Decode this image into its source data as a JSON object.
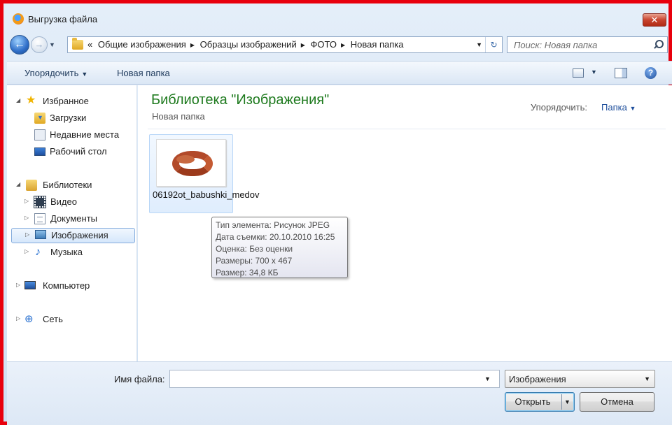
{
  "window": {
    "title": "Выгрузка файла",
    "close_glyph": "✕"
  },
  "navigation": {
    "back_glyph": "←",
    "forward_glyph": "→",
    "breadcrumb_overflow": "«",
    "breadcrumbs": [
      "Общие изображения",
      "Образцы изображений",
      "ФОТО",
      "Новая папка"
    ],
    "refresh_glyph": "↻"
  },
  "search": {
    "placeholder": "Поиск: Новая папка"
  },
  "toolbar": {
    "organize_label": "Упорядочить",
    "new_folder_label": "Новая папка",
    "help_glyph": "?"
  },
  "sidebar": {
    "favorites": {
      "label": "Избранное",
      "items": [
        "Загрузки",
        "Недавние места",
        "Рабочий стол"
      ]
    },
    "libraries": {
      "label": "Библиотеки",
      "items": [
        "Видео",
        "Документы",
        "Изображения",
        "Музыка"
      ],
      "selected": "Изображения"
    },
    "computer": "Компьютер",
    "network": "Сеть"
  },
  "content": {
    "library_title": "Библиотека \"Изображения\"",
    "subtitle": "Новая папка",
    "arrange_label": "Упорядочить:",
    "arrange_value": "Папка",
    "files": [
      {
        "name": "06192ot_babushki_medov"
      }
    ],
    "tooltip": {
      "type": "Тип элемента: Рисунок JPEG",
      "date": "Дата съемки: 20.10.2010 16:25",
      "rating": "Оценка: Без оценки",
      "dimensions": "Размеры: 700 x 467",
      "size": "Размер: 34,8 КБ"
    }
  },
  "bottom": {
    "filename_label": "Имя файла:",
    "filename_value": "",
    "filetype_value": "Изображения",
    "open_label": "Открыть",
    "cancel_label": "Отмена"
  }
}
